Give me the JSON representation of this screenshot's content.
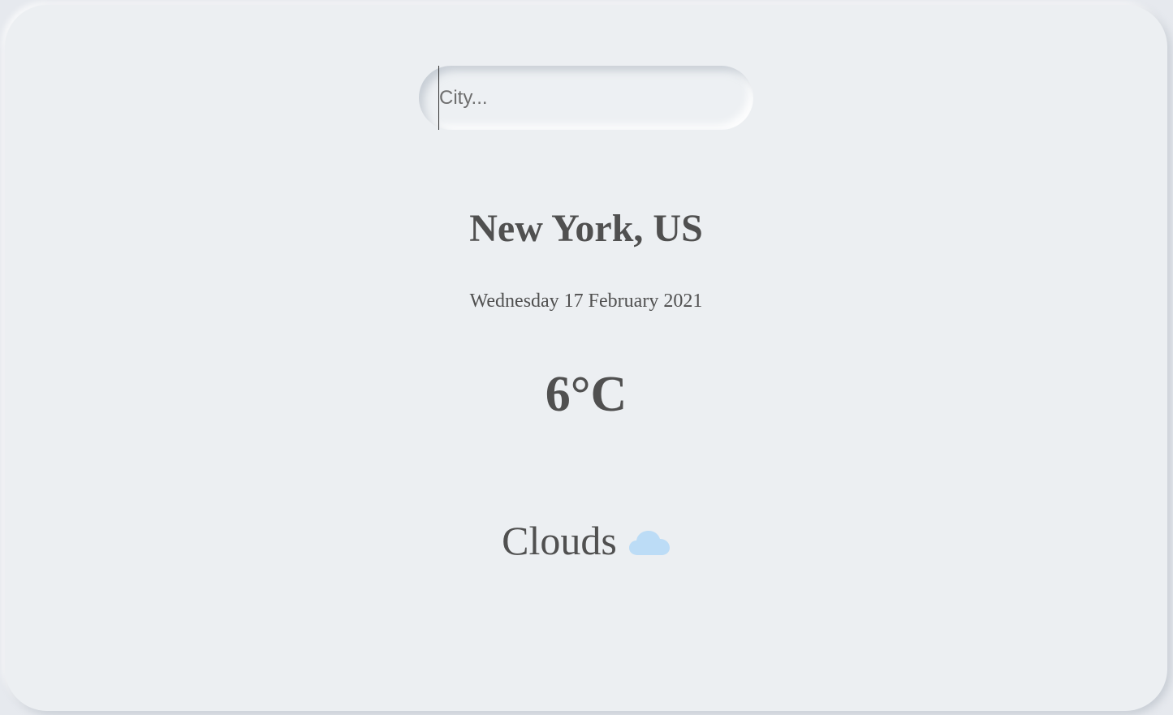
{
  "search": {
    "placeholder": "City...",
    "value": ""
  },
  "weather": {
    "location": "New York, US",
    "date": "Wednesday 17 February 2021",
    "temperature": "6°C",
    "condition": "Clouds",
    "condition_icon": "cloud-icon"
  },
  "colors": {
    "background": "#eceff2",
    "text": "#505050",
    "cloud": "#bcdcf6"
  }
}
